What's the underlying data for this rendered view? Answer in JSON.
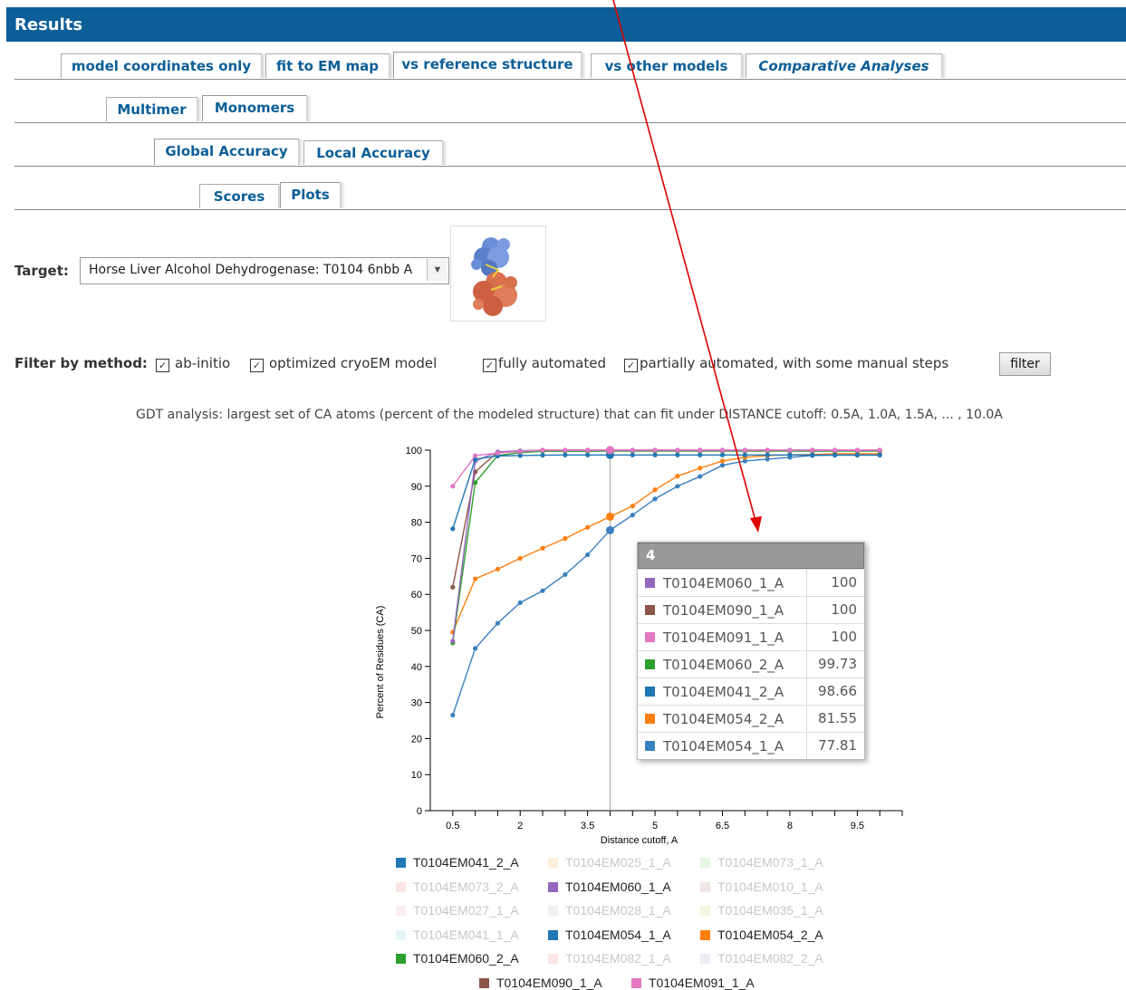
{
  "header": {
    "title": "Results"
  },
  "tabs_main": [
    {
      "label": "model coordinates only",
      "active": false
    },
    {
      "label": "fit to EM map",
      "active": false
    },
    {
      "label": "vs reference structure",
      "active": true
    },
    {
      "label": "vs other models",
      "active": false
    },
    {
      "label": "Comparative Analyses",
      "active": false
    }
  ],
  "tabs_sub": [
    {
      "label": "Multimer",
      "active": false
    },
    {
      "label": "Monomers",
      "active": true
    }
  ],
  "tabs_accuracy": [
    {
      "label": "Global Accuracy",
      "active": true
    },
    {
      "label": "Local Accuracy",
      "active": false
    }
  ],
  "tabs_view": [
    {
      "label": "Scores",
      "active": false
    },
    {
      "label": "Plots",
      "active": true
    }
  ],
  "target": {
    "label": "Target:",
    "value": "Horse Liver Alcohol Dehydrogenase: T0104  6nbb  A"
  },
  "filter": {
    "label": "Filter by method:",
    "options": [
      {
        "label": "ab-initio",
        "checked": true
      },
      {
        "label": "optimized cryoEM model",
        "checked": true
      },
      {
        "label": "fully automated",
        "checked": true
      },
      {
        "label": "partially automated, with some manual steps",
        "checked": true
      }
    ],
    "button": "filter"
  },
  "description": "GDT analysis: largest set of CA atoms (percent of the modeled structure) that can fit under DISTANCE cutoff: 0.5A, 1.0A, 1.5A, ... , 10.0A",
  "tooltip": {
    "title": "4",
    "rows": [
      {
        "name": "T0104EM060_1_A",
        "value": "100",
        "color": "#9467bd"
      },
      {
        "name": "T0104EM090_1_A",
        "value": "100",
        "color": "#8c564b"
      },
      {
        "name": "T0104EM091_1_A",
        "value": "100",
        "color": "#e377c2"
      },
      {
        "name": "T0104EM060_2_A",
        "value": "99.73",
        "color": "#2ca02c"
      },
      {
        "name": "T0104EM041_2_A",
        "value": "98.66",
        "color": "#1f77b4"
      },
      {
        "name": "T0104EM054_2_A",
        "value": "81.55",
        "color": "#ff7f0e"
      },
      {
        "name": "T0104EM054_1_A",
        "value": "77.81",
        "color": "#3b80c0"
      }
    ]
  },
  "legend": [
    {
      "name": "T0104EM041_2_A",
      "color": "#1f77b4",
      "visible": true
    },
    {
      "name": "T0104EM025_1_A",
      "color": "#ffbb78",
      "visible": false
    },
    {
      "name": "T0104EM073_1_A",
      "color": "#98df8a",
      "visible": false
    },
    {
      "name": "T0104EM073_2_A",
      "color": "#ff9896",
      "visible": false
    },
    {
      "name": "T0104EM060_1_A",
      "color": "#9467bd",
      "visible": true
    },
    {
      "name": "T0104EM010_1_A",
      "color": "#c49c94",
      "visible": false
    },
    {
      "name": "T0104EM027_1_A",
      "color": "#f7b6d2",
      "visible": false
    },
    {
      "name": "T0104EM028_1_A",
      "color": "#c7c7c7",
      "visible": false
    },
    {
      "name": "T0104EM035_1_A",
      "color": "#dbdb8d",
      "visible": false
    },
    {
      "name": "T0104EM041_1_A",
      "color": "#9edae5",
      "visible": false
    },
    {
      "name": "T0104EM054_1_A",
      "color": "#1f77b4",
      "visible": true
    },
    {
      "name": "T0104EM054_2_A",
      "color": "#ff7f0e",
      "visible": true
    },
    {
      "name": "T0104EM060_2_A",
      "color": "#2ca02c",
      "visible": true
    },
    {
      "name": "T0104EM082_1_A",
      "color": "#ff9896",
      "visible": false
    },
    {
      "name": "T0104EM082_2_A",
      "color": "#c5b0d5",
      "visible": false
    },
    {
      "name": "T0104EM090_1_A",
      "color": "#8c564b",
      "visible": true
    },
    {
      "name": "T0104EM091_1_A",
      "color": "#e377c2",
      "visible": true
    }
  ],
  "chart_data": {
    "type": "line",
    "xlabel": "Distance cutoff, A",
    "ylabel": "Percent of Residues (CA)",
    "xlim": [
      0,
      10.5
    ],
    "ylim": [
      0,
      100
    ],
    "xticks": [
      "0.5",
      "2",
      "3.5",
      "5",
      "6.5",
      "8",
      "9.5"
    ],
    "yticks": [
      "0",
      "10",
      "20",
      "30",
      "40",
      "50",
      "60",
      "70",
      "80",
      "90",
      "100"
    ],
    "hover_x": 4,
    "x": [
      0.5,
      1.0,
      1.5,
      2.0,
      2.5,
      3.0,
      3.5,
      4.0,
      4.5,
      5.0,
      5.5,
      6.0,
      6.5,
      7.0,
      7.5,
      8.0,
      8.5,
      9.0,
      9.5,
      10.0
    ],
    "series": [
      {
        "name": "T0104EM054_1_A",
        "color": "#3b80c0",
        "values": [
          26.5,
          45,
          52,
          57.7,
          61,
          65.5,
          71,
          77.81,
          82,
          86.5,
          90,
          92.7,
          95.8,
          97,
          97.5,
          98,
          98.5,
          98.6,
          98.6,
          98.6
        ]
      },
      {
        "name": "T0104EM054_2_A",
        "color": "#ff7f0e",
        "values": [
          49.5,
          64.3,
          67,
          70,
          72.8,
          75.5,
          78.6,
          81.55,
          84.5,
          89,
          92.8,
          95,
          97,
          98,
          98.5,
          98.7,
          98.8,
          99,
          99,
          99
        ]
      },
      {
        "name": "T0104EM060_2_A",
        "color": "#2ca02c",
        "values": [
          46.5,
          91,
          98.5,
          99.3,
          99.7,
          99.7,
          99.7,
          99.73,
          99.73,
          99.73,
          99.73,
          99.73,
          99.73,
          99.73,
          99.73,
          99.73,
          99.73,
          99.73,
          99.73,
          99.73
        ]
      },
      {
        "name": "T0104EM090_1_A",
        "color": "#8c564b",
        "values": [
          62,
          94,
          99.5,
          99.8,
          100,
          100,
          100,
          100,
          100,
          100,
          100,
          100,
          100,
          100,
          100,
          100,
          100,
          100,
          100,
          100
        ]
      },
      {
        "name": "T0104EM060_1_A",
        "color": "#9467bd",
        "values": [
          47,
          97,
          99.5,
          99.8,
          100,
          100,
          100,
          100,
          100,
          100,
          100,
          100,
          100,
          100,
          100,
          100,
          100,
          100,
          100,
          100
        ]
      },
      {
        "name": "T0104EM041_2_A",
        "color": "#1f77b4",
        "values": [
          78.2,
          97.5,
          98.4,
          98.5,
          98.6,
          98.66,
          98.66,
          98.66,
          98.66,
          98.66,
          98.66,
          98.66,
          98.66,
          98.66,
          98.66,
          98.66,
          98.66,
          98.66,
          98.66,
          98.66
        ]
      },
      {
        "name": "T0104EM091_1_A",
        "color": "#e377c2",
        "values": [
          90,
          98.5,
          99.2,
          99.6,
          100,
          100,
          100,
          100,
          100,
          100,
          100,
          100,
          100,
          100,
          100,
          100,
          100,
          100,
          100,
          100
        ]
      }
    ]
  },
  "annotation": {
    "color": "#e00000"
  }
}
